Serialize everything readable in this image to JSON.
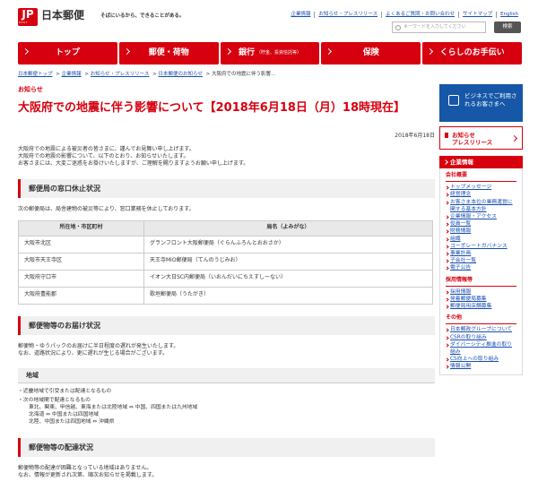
{
  "header": {
    "logo_mark": "JP",
    "logo_sub": "POST",
    "logo_name": "日本郵便",
    "tagline": "そばにいるから、できることがある。",
    "links": [
      "企業情報",
      "お知らせ・プレスリリース",
      "よくあるご質問・お問い合わせ",
      "サイトマップ",
      "English"
    ],
    "search_placeholder": "キーワードを入力してください",
    "search_button": "検索"
  },
  "nav": [
    {
      "label": "トップ"
    },
    {
      "label": "郵便・荷物"
    },
    {
      "label": "銀行",
      "sub": "（貯金、投資信託等）"
    },
    {
      "label": "保険"
    },
    {
      "label": "くらしのお手伝い"
    }
  ],
  "breadcrumb": [
    "日本郵便トップ",
    "企業情報",
    "お知らせ・プレスリリース",
    "日本郵便のお知らせ",
    "大阪府での地震に伴う影響…"
  ],
  "main": {
    "kicker": "お知らせ",
    "title": "大阪府での地震に伴う影響について【2018年6月18日（月）18時現在】",
    "date": "2018年6月18日",
    "intro": [
      "大阪府での地震による被災者の皆さまに、謹んでお見舞い申し上げます。",
      "大阪府での地震の影響について、以下のとおり、お知らせいたします。",
      "お客さまには、大変ご迷惑をお掛けいたしますが、ご理解を賜りますようお願い申し上げます。"
    ],
    "section1_title": "郵便局の窓口休止状況",
    "section1_text": "次の郵便局は、局舎建物の被災等により、窓口業務を休止しております。",
    "table_headers": [
      "所在地・市区町村",
      "局名（よみがな）"
    ],
    "table_rows": [
      [
        "大阪市北区",
        "グランフロント大阪郵便局（ぐらんふろんとおおさか）"
      ],
      [
        "大阪市天王寺区",
        "天王寺MiO郵便局（てんのうじみお）"
      ],
      [
        "大阪府守口市",
        "イオン大日SC内郵便局（いおんだいにちえすしーない）"
      ],
      [
        "大阪府豊能郡",
        "歌垣郵便局（うたがき）"
      ]
    ],
    "section2_title": "郵便物等のお届け状況",
    "section2_text": [
      "郵便物・ゆうパックのお届けに半日程度の遅れが発生いたします。",
      "なお、道路状況により、更に遅れが生じる場合がございます。"
    ],
    "area_title": "地域",
    "area_items": [
      "・近畿地域で引受または配達となるもの",
      "・次の地域間で配達となるもの"
    ],
    "area_sub": [
      "東北、関東、甲信越、東海または北陸地域 ⇔ 中国、四国または九州地域",
      "北海道 ⇔ 中国または四国地域",
      "北陸、中国または四国地域 ⇔ 沖縄県"
    ],
    "section3_title": "郵便物等の配達状況",
    "section3_text": [
      "郵便物等の配達が困難となっている地域はありません。",
      "なお、情報が更新され次第、順次お知らせを掲載します。"
    ]
  },
  "sidebar": {
    "biz_label": "ビジネスでご利用されるお客さまへ",
    "press_label": "お知らせ\nプレスリリース",
    "head_label": "企業情報",
    "group1_title": "会社概要",
    "group1_links": [
      "トップメッセージ",
      "経営理念",
      "お客さま本位の業務運営に関する基本方針",
      "企業情報・アクセス",
      "役員一覧",
      "財務情報",
      "組織",
      "コーポレートガバナンス",
      "事業計画",
      "子会社一覧",
      "電子公告"
    ],
    "group2_title": "採用情報等",
    "group2_links": [
      "採用情報",
      "発着郵便局募集",
      "郵便局用店舗募集"
    ],
    "group3_title": "その他",
    "group3_links": [
      "日本郵政グループについて",
      "CSRの取り組み",
      "ダイバーシティ推進の取り組み",
      "CS向上への取り組み",
      "情報公開"
    ]
  }
}
